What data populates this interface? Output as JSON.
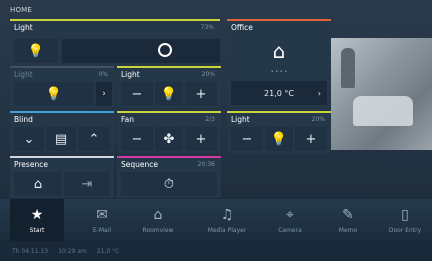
{
  "breadcrumb": "HOME",
  "tiles": {
    "light_main": {
      "title": "Light",
      "value": "73%",
      "level": 0.73
    },
    "office": {
      "title": "Office",
      "temperature": "21,0 °C",
      "dots": "• • • •"
    },
    "light_dim": {
      "title": "Light",
      "value": "0%"
    },
    "light_b": {
      "title": "Light",
      "value": "20%"
    },
    "blind": {
      "title": "Blind"
    },
    "fan": {
      "title": "Fan",
      "value": "2/3"
    },
    "light_c": {
      "title": "Light",
      "value": "20%"
    },
    "presence": {
      "title": "Presence"
    },
    "sequence": {
      "title": "Sequence",
      "value": "20:36"
    }
  },
  "dock": [
    {
      "label": "Start",
      "icon": "star-icon",
      "active": true
    },
    {
      "label": "E-Mail",
      "icon": "mail-icon"
    },
    {
      "label": "Roomview",
      "icon": "house-icon"
    },
    {
      "label": "Media Player",
      "icon": "music-icon"
    },
    {
      "label": "Camera",
      "icon": "camera-icon"
    },
    {
      "label": "Memo",
      "icon": "memo-icon"
    },
    {
      "label": "Door Entry",
      "icon": "door-icon"
    }
  ],
  "status": {
    "date": "Th 04.11.13",
    "time": "10:29 am",
    "temp": "21,0 °C"
  },
  "colors": {
    "accent_yellow": "#c9d33a",
    "accent_orange": "#e0643c",
    "accent_blue": "#3ea2d6",
    "accent_magenta": "#d43aa4"
  }
}
